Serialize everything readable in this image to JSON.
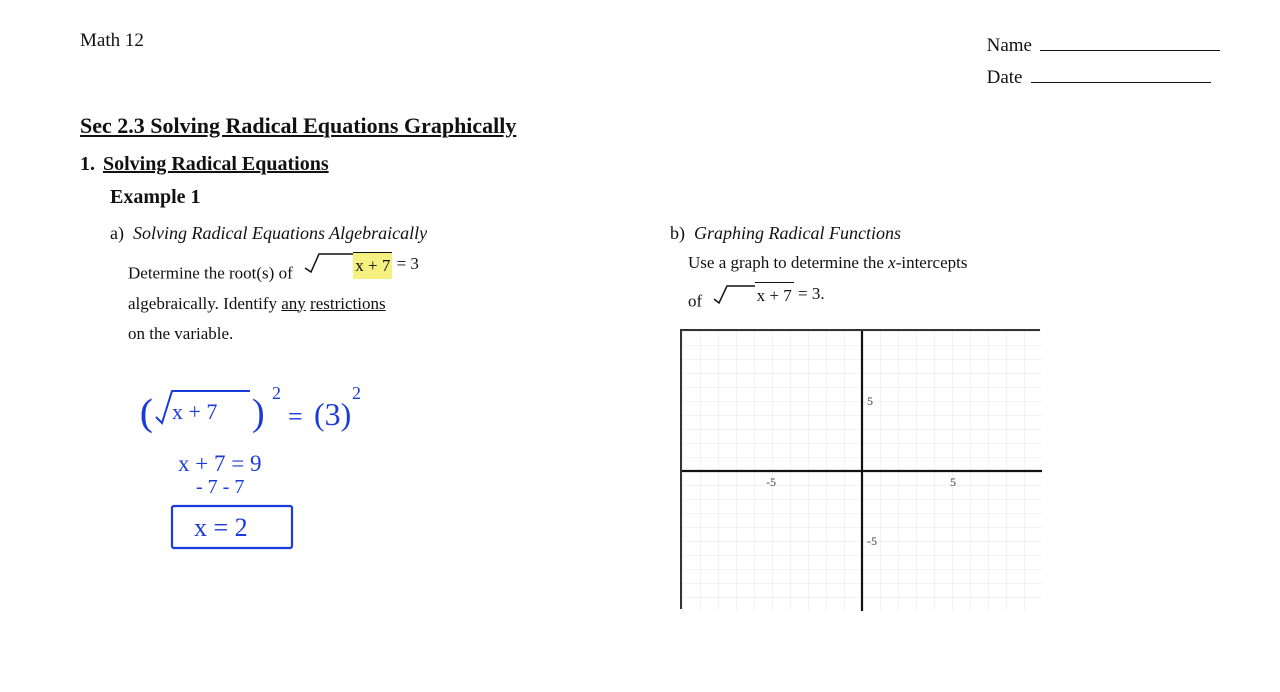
{
  "header": {
    "course": "Math 12",
    "name_label": "Name",
    "date_label": "Date"
  },
  "section": {
    "title": "Sec 2.3 Solving Radical Equations Graphically"
  },
  "problem1": {
    "number": "1.",
    "heading": "Solving Radical Equations",
    "example": "Example 1",
    "partA": {
      "label": "a)",
      "subtitle": "Solving Radical Equations Algebraically",
      "text1": "Determine the root(s) of",
      "equation1": "√x + 7 = 3",
      "text2": "algebraically. Identify",
      "text2_any": "any",
      "text2_rest": "restrictions",
      "text3": "on the variable."
    },
    "partB": {
      "label": "b)",
      "subtitle": "Graphing Radical Functions",
      "text1": "Use a graph to determine the x-intercepts",
      "text2": "of",
      "equation": "√x + 7 = 3."
    }
  },
  "graph": {
    "x_min": -10,
    "x_max": 10,
    "y_min": -10,
    "y_max": 10,
    "label_pos5": "5",
    "label_neg5": "-5",
    "label_x5": "5",
    "label_xneg5": "-5"
  }
}
